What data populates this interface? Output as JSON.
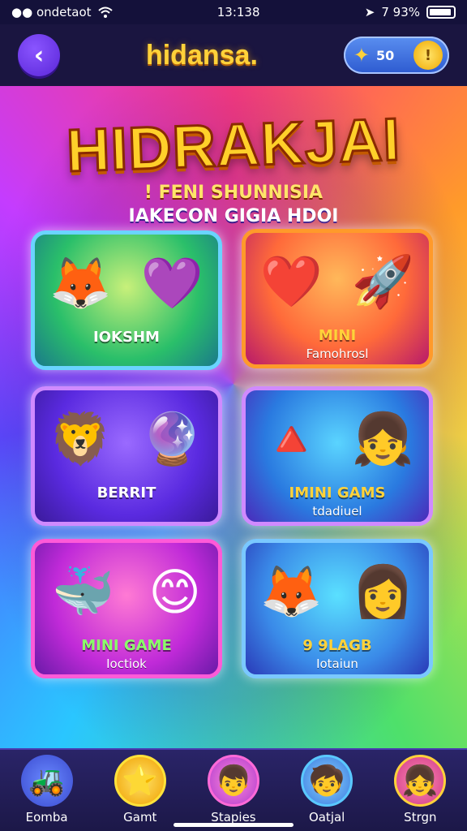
{
  "status_bar": {
    "carrier": "●● ondetaot",
    "wifi_icon": "wifi-icon",
    "time": "13:138",
    "location_glyph": "➤",
    "battery_text": "7 93%",
    "battery_level": 0.93
  },
  "header": {
    "back_glyph": "‹",
    "title": "hidansa.",
    "coins": "50",
    "coin_glyph": "✦",
    "coin_button_glyph": "!"
  },
  "hero": {
    "title": "HIDRAKJAI",
    "subtitle": "! FENI SHUNNISIA",
    "tagline": "IAKECON GIGIA HDOI"
  },
  "cards": [
    {
      "art": [
        "🦊",
        "💜"
      ],
      "title": "IOKSHM",
      "subtitle": ""
    },
    {
      "art": [
        "❤️",
        "🚀"
      ],
      "title": "MINI",
      "subtitle": "Famohrosl"
    },
    {
      "art": [
        "🦁",
        "🔮"
      ],
      "title": "BERRIT",
      "subtitle": ""
    },
    {
      "art": [
        "🔺",
        "👧"
      ],
      "title": "IMINI GAMS",
      "subtitle": "tdadiuel"
    },
    {
      "art": [
        "🐳",
        "😊"
      ],
      "title": "MINI GAME",
      "subtitle": "Ioctiok"
    },
    {
      "art": [
        "🦊",
        "👩"
      ],
      "title": "9 9LAGB",
      "subtitle": "Iotaiun"
    }
  ],
  "nav": [
    {
      "label": "Eomba",
      "icon": "🚜",
      "icon_name": "vehicle-icon"
    },
    {
      "label": "Gamt",
      "icon": "⭐",
      "icon_name": "star-icon"
    },
    {
      "label": "Stapies",
      "icon": "👦",
      "icon_name": "character-icon"
    },
    {
      "label": "Oatjal",
      "icon": "🧒",
      "icon_name": "kid-icon"
    },
    {
      "label": "Strgn",
      "icon": "👧",
      "icon_name": "girl-icon"
    }
  ]
}
